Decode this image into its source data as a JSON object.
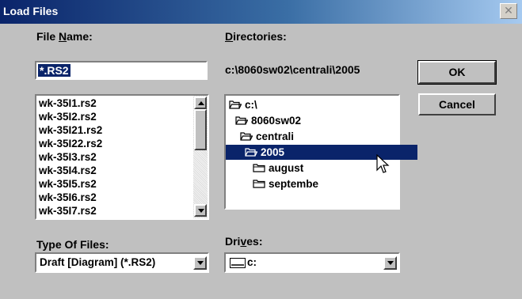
{
  "window": {
    "title": "Load Files",
    "close_icon": "x-icon"
  },
  "file_name": {
    "label_prefix": "File ",
    "label_hotkey": "N",
    "label_suffix": "ame:",
    "value": "*.RS2"
  },
  "directories": {
    "label_hotkey": "D",
    "label_suffix": "irectories:",
    "current_path": "c:\\8060sw02\\centrali\\2005",
    "tree": [
      {
        "label": "c:\\",
        "icon": "open-folder-icon",
        "selected": false
      },
      {
        "label": "8060sw02",
        "icon": "open-folder-icon",
        "selected": false
      },
      {
        "label": "centrali",
        "icon": "open-folder-icon",
        "selected": false
      },
      {
        "label": "2005",
        "icon": "open-folder-icon",
        "selected": true
      },
      {
        "label": "august",
        "icon": "folder-icon",
        "selected": false
      },
      {
        "label": "septembe",
        "icon": "folder-icon",
        "selected": false
      }
    ]
  },
  "files": [
    "wk-35I1.rs2",
    "wk-35I2.rs2",
    "wk-35I21.rs2",
    "wk-35I22.rs2",
    "wk-35I3.rs2",
    "wk-35I4.rs2",
    "wk-35I5.rs2",
    "wk-35I6.rs2",
    "wk-35I7.rs2"
  ],
  "buttons": {
    "ok": "OK",
    "cancel": "Cancel"
  },
  "type_of_files": {
    "label": "Type Of Files:",
    "value": "Draft [Diagram]  (*.RS2)"
  },
  "drives": {
    "label_prefix": "Dri",
    "label_hotkey": "v",
    "label_suffix": "es:",
    "value": "c:",
    "icon": "drive-icon"
  }
}
